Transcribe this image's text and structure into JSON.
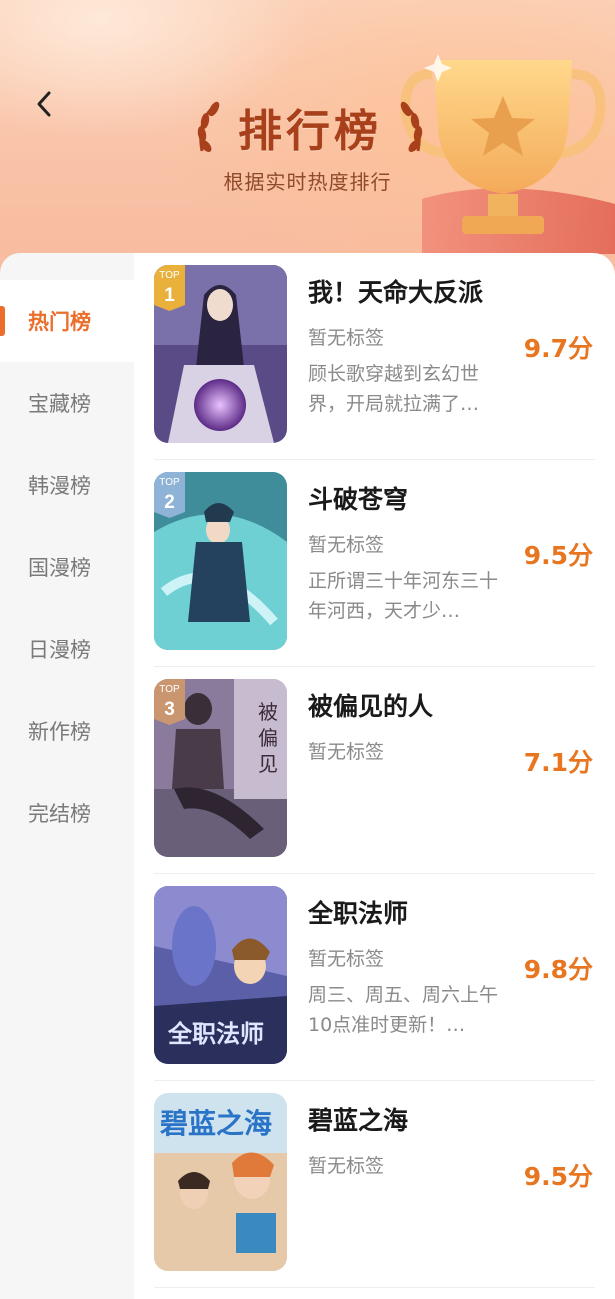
{
  "header": {
    "title": "排行榜",
    "subtitle": "根据实时热度排行"
  },
  "sidebar": {
    "items": [
      {
        "label": "热门榜",
        "active": true
      },
      {
        "label": "宝藏榜",
        "active": false
      },
      {
        "label": "韩漫榜",
        "active": false
      },
      {
        "label": "国漫榜",
        "active": false
      },
      {
        "label": "日漫榜",
        "active": false
      },
      {
        "label": "新作榜",
        "active": false
      },
      {
        "label": "完结榜",
        "active": false
      }
    ]
  },
  "rank_badge": {
    "top_label": "TOP"
  },
  "books": [
    {
      "rank": "1",
      "title": "我！天命大反派",
      "tag": "暂无标签",
      "desc": "顾长歌穿越到玄幻世界，开局就拉满了…",
      "score": "9.7分",
      "badge_color": "#e9b03c"
    },
    {
      "rank": "2",
      "title": "斗破苍穹",
      "tag": "暂无标签",
      "desc": "正所谓三十年河东三十年河西，天才少…",
      "score": "9.5分",
      "badge_color": "#8fb3d6"
    },
    {
      "rank": "3",
      "title": "被偏见的人",
      "tag": "暂无标签",
      "desc": "",
      "score": "7.1分",
      "badge_color": "#c9966f"
    },
    {
      "rank": "",
      "title": "全职法师",
      "tag": "暂无标签",
      "desc": "周三、周五、周六上午10点准时更新！…",
      "score": "9.8分",
      "badge_color": ""
    },
    {
      "rank": "",
      "title": "碧蓝之海",
      "tag": "暂无标签",
      "desc": "",
      "score": "9.5分",
      "badge_color": ""
    }
  ],
  "colors": {
    "accent": "#ea6f2c",
    "score": "#e8751f",
    "title_brown": "#a8401b"
  }
}
